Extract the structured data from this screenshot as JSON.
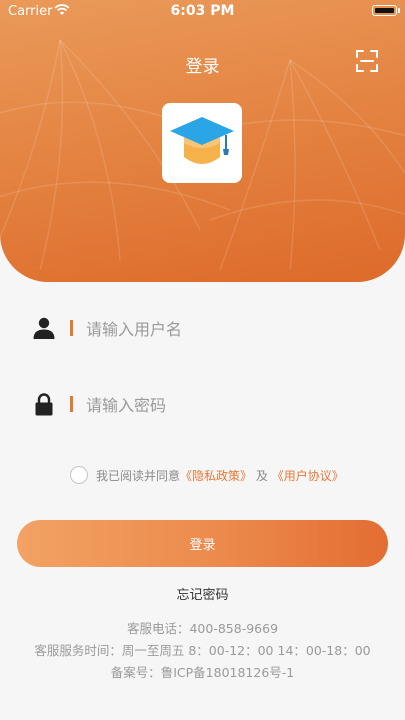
{
  "status_bar": {
    "carrier": "Carrier",
    "time": "6:03 PM"
  },
  "header": {
    "title": "登录",
    "scan_icon": "scan-icon",
    "logo_icon": "graduation-cap-icon"
  },
  "form": {
    "username_placeholder": "请输入用户名",
    "username_value": "",
    "password_placeholder": "请输入密码",
    "password_value": ""
  },
  "agreement": {
    "checked": false,
    "prefix": "我已阅读并同意",
    "privacy_link": "《隐私政策》",
    "and": "及",
    "user_link": "《用户协议》"
  },
  "login_button": "登录",
  "forgot_password": "忘记密码",
  "footer": {
    "hotline": "客服电话：400-858-9669",
    "hours": "客服服务时间：周一至周五 8：00-12：00 14：00-18：00",
    "icp": "备案号：鲁ICP备18018126号-1"
  },
  "colors": {
    "accent": "#e3803e",
    "link": "#e6793a",
    "button_start": "#f2a264",
    "button_end": "#e36d32"
  }
}
